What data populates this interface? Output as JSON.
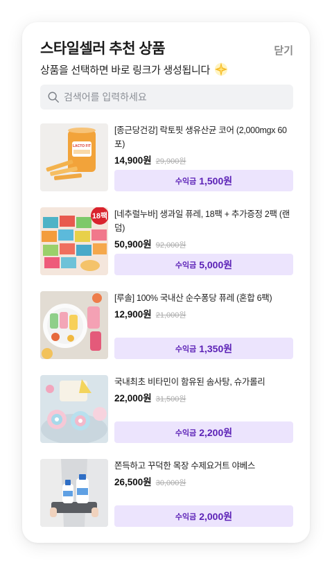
{
  "header": {
    "title": "스타일셀러 추천 상품",
    "close_label": "닫기",
    "subtitle": "상품을 선택하면 바로 링크가 생성됩니다"
  },
  "search": {
    "placeholder": "검색어를 입력하세요",
    "value": ""
  },
  "earn_label": "수익금",
  "products": [
    {
      "name": "[종근당건강] 락토핏 생유산균 코어 (2,000mgx 60포)",
      "price": "14,900원",
      "original_price": "29,900원",
      "earnings": "1,500원",
      "thumb_text": "LACTO FIT"
    },
    {
      "name": "[네추럴누바] 생과일 퓨레, 18팩 + 추가증정 2팩 (랜덤)",
      "price": "50,900원",
      "original_price": "92,000원",
      "earnings": "5,000원",
      "badge": "18팩"
    },
    {
      "name": "[루솔] 100% 국내산 순수퐁당 퓨레 (혼합 6팩)",
      "price": "12,900원",
      "original_price": "21,000원",
      "earnings": "1,350원"
    },
    {
      "name": "국내최초 비타민이 함유된 솜사탕, 슈가롤리",
      "price": "22,000원",
      "original_price": "31,500원",
      "earnings": "2,200원"
    },
    {
      "name": "쫀득하고 꾸덕한 목장 수제요거트 야베스",
      "price": "26,500원",
      "original_price": "30,000원",
      "earnings": "2,000원"
    }
  ],
  "colors": {
    "accent": "#5b21b6",
    "accent_bg": "#ece4fd",
    "search_bg": "#f1f2f4"
  }
}
